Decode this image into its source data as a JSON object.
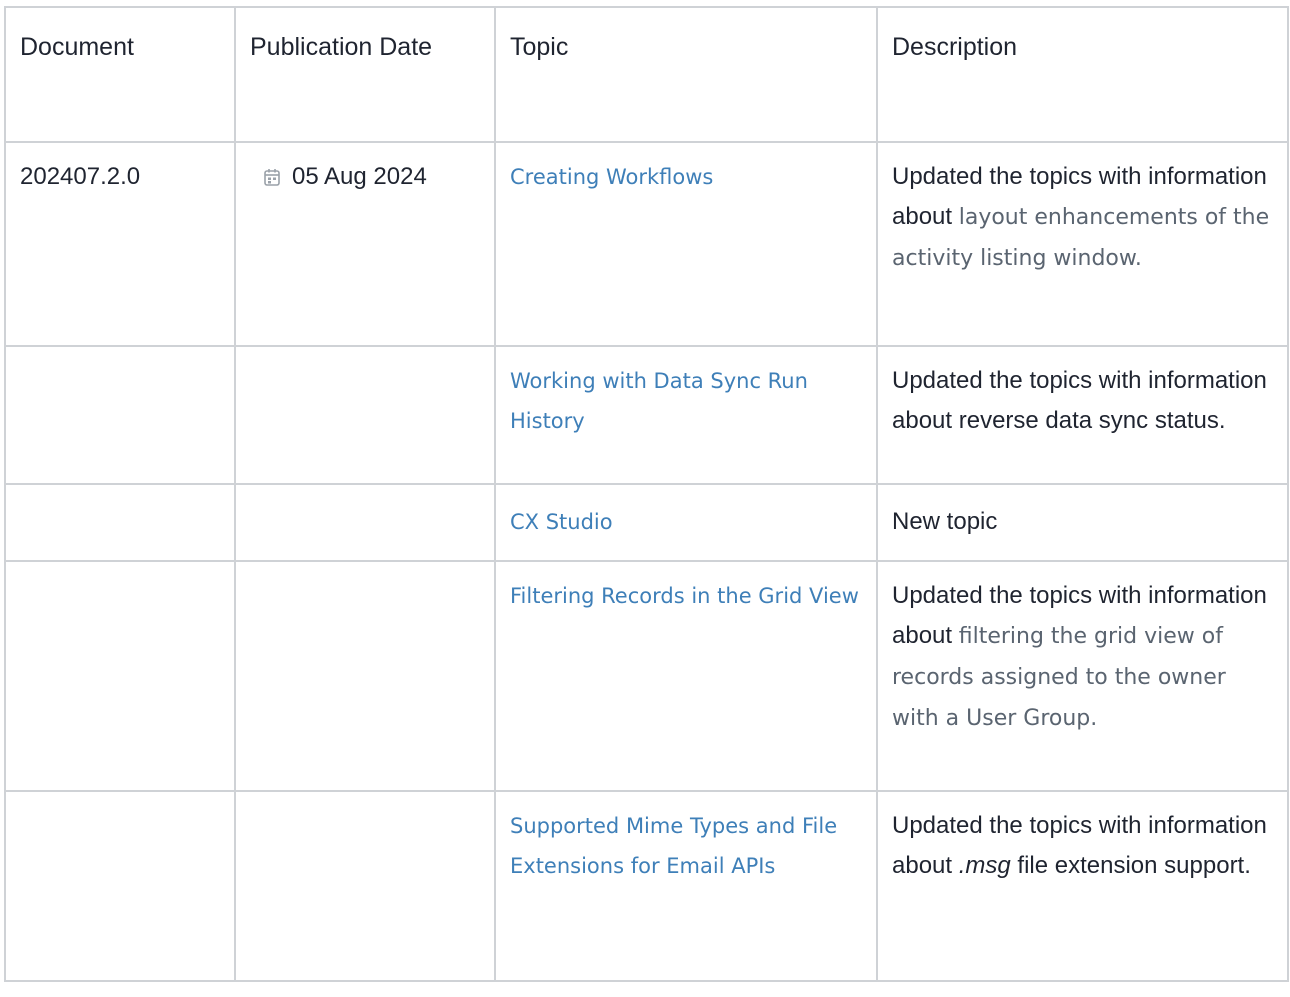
{
  "table": {
    "headers": [
      "Document",
      "Publication Date",
      "Topic",
      "Description"
    ],
    "rows": [
      {
        "document": "202407.2.0",
        "date": "05 Aug 2024",
        "topic": "Creating Workflows",
        "desc_a": "Updated the topics with information about ",
        "desc_b": "layout enhancements of the activity listing window."
      },
      {
        "document": "",
        "date": "",
        "topic": "Working with Data Sync Run History",
        "desc": "Updated the topics with information about reverse data sync status."
      },
      {
        "document": "",
        "date": "",
        "topic": "CX Studio",
        "desc": "New topic"
      },
      {
        "document": "",
        "date": "",
        "topic": "Filtering Records in the Grid View",
        "desc_a": "Updated the topics with information about ",
        "desc_b": "filtering the grid view of records assigned to the owner with a User Group."
      },
      {
        "document": "",
        "date": "",
        "topic": "Supported Mime Types and File Extensions for Email APIs",
        "desc_a": "Updated the topics with information about ",
        "desc_em": ".msg",
        "desc_b": " file extension support."
      }
    ]
  },
  "icons": {
    "calendar": "calendar-icon"
  },
  "colors": {
    "link": "#3e7fb8",
    "border": "#cfd2d6",
    "text": "#1f2430"
  }
}
